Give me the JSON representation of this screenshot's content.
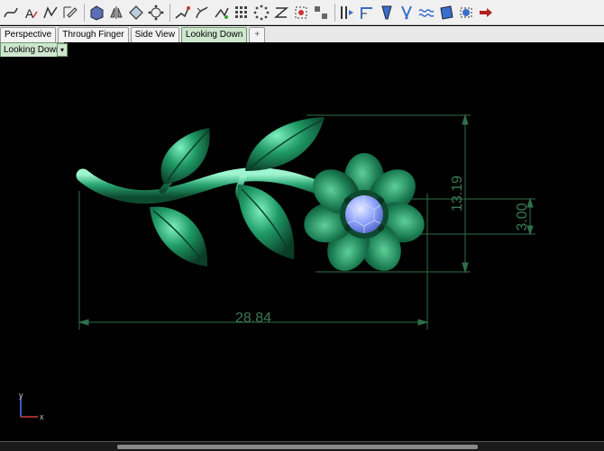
{
  "toolbar": {
    "icons": [
      "curve-icon",
      "text-icon",
      "polyline-icon",
      "edit-icon",
      "box-icon",
      "mirror-icon",
      "diamond-icon",
      "sphere-point-icon",
      "draw-icon",
      "sweep-icon",
      "pattern-icon",
      "grid-icon",
      "circle-dots-icon",
      "spiral-icon",
      "bounding-icon",
      "array-icon",
      "flip-icon",
      "bend-icon",
      "taper-icon",
      "twist-icon",
      "wave-icon",
      "flow-icon",
      "cage-icon",
      "arrow-right-icon"
    ]
  },
  "tabs": [
    {
      "label": "Perspective",
      "active": false
    },
    {
      "label": "Through Finger",
      "active": false
    },
    {
      "label": "Side View",
      "active": false
    },
    {
      "label": "Looking Down",
      "active": true
    }
  ],
  "tab_add_symbol": "+",
  "viewport_label": "Looking Down",
  "viewport_dropdown_symbol": "▾",
  "dimensions": {
    "width_value": "28.84",
    "height_value": "13.19",
    "stone_value": "3.00"
  },
  "axes": {
    "y": "y",
    "x": "x"
  },
  "colors": {
    "viewport_bg": "#000000",
    "dimension_line": "#2f6f4a",
    "dimension_text": "#3a7a55",
    "model_green": "#1f8a5e",
    "model_highlight": "#7ff0c0",
    "gem": "#8fa8ff",
    "tab_active": "#cfe6cf"
  }
}
